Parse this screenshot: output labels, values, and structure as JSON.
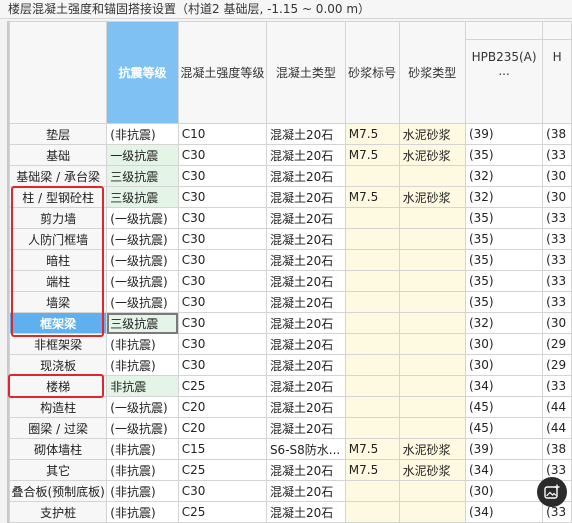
{
  "title": "楼层混凝土强度和锚固搭接设置（村道2  基础层, -1.15 ~ 0.00 m）",
  "headers": {
    "seismic": "抗震等级",
    "concrete_grade": "混凝土强度等级",
    "concrete_type": "混凝土类型",
    "mortar_grade": "砂浆标号",
    "mortar_type": "砂浆类型",
    "hpb235": "HPB235(A)",
    "hpb235_more": "...",
    "next_col": "H"
  },
  "rows": [
    {
      "name": "垫层",
      "seismic": "(非抗震)",
      "grade": "C10",
      "ctype": "混凝土20石",
      "mgrade": "M7.5",
      "mtype": "水泥砂浆",
      "hpb": "(39)",
      "next": "(38"
    },
    {
      "name": "基础",
      "seismic": "一级抗震",
      "grade": "C30",
      "ctype": "混凝土20石",
      "mgrade": "M7.5",
      "mtype": "水泥砂浆",
      "hpb": "(35)",
      "next": "(33"
    },
    {
      "name": "基础梁 / 承台梁",
      "seismic": "三级抗震",
      "grade": "C30",
      "ctype": "混凝土20石",
      "mgrade": "",
      "mtype": "",
      "hpb": "(32)",
      "next": "(30"
    },
    {
      "name": "柱 / 型钢砼柱",
      "seismic": "三级抗震",
      "grade": "C30",
      "ctype": "混凝土20石",
      "mgrade": "M7.5",
      "mtype": "水泥砂浆",
      "hpb": "(32)",
      "next": "(30"
    },
    {
      "name": "剪力墙",
      "seismic": "(一级抗震)",
      "grade": "C30",
      "ctype": "混凝土20石",
      "mgrade": "",
      "mtype": "",
      "hpb": "(35)",
      "next": "(33"
    },
    {
      "name": "人防门框墙",
      "seismic": "(一级抗震)",
      "grade": "C30",
      "ctype": "混凝土20石",
      "mgrade": "",
      "mtype": "",
      "hpb": "(35)",
      "next": "(33"
    },
    {
      "name": "暗柱",
      "seismic": "(一级抗震)",
      "grade": "C30",
      "ctype": "混凝土20石",
      "mgrade": "",
      "mtype": "",
      "hpb": "(35)",
      "next": "(33"
    },
    {
      "name": "端柱",
      "seismic": "(一级抗震)",
      "grade": "C30",
      "ctype": "混凝土20石",
      "mgrade": "",
      "mtype": "",
      "hpb": "(35)",
      "next": "(33"
    },
    {
      "name": "墙梁",
      "seismic": "(一级抗震)",
      "grade": "C30",
      "ctype": "混凝土20石",
      "mgrade": "",
      "mtype": "",
      "hpb": "(35)",
      "next": "(33"
    },
    {
      "name": "框架梁",
      "seismic": "三级抗震",
      "grade": "C30",
      "ctype": "混凝土20石",
      "mgrade": "",
      "mtype": "",
      "hpb": "(32)",
      "next": "(30"
    },
    {
      "name": "非框架梁",
      "seismic": "(非抗震)",
      "grade": "C30",
      "ctype": "混凝土20石",
      "mgrade": "",
      "mtype": "",
      "hpb": "(30)",
      "next": "(29"
    },
    {
      "name": "现浇板",
      "seismic": "(非抗震)",
      "grade": "C30",
      "ctype": "混凝土20石",
      "mgrade": "",
      "mtype": "",
      "hpb": "(30)",
      "next": "(29"
    },
    {
      "name": "楼梯",
      "seismic": "非抗震",
      "grade": "C25",
      "ctype": "混凝土20石",
      "mgrade": "",
      "mtype": "",
      "hpb": "(34)",
      "next": "(33"
    },
    {
      "name": "构造柱",
      "seismic": "(一级抗震)",
      "grade": "C20",
      "ctype": "混凝土20石",
      "mgrade": "",
      "mtype": "",
      "hpb": "(45)",
      "next": "(44"
    },
    {
      "name": "圈梁 / 过梁",
      "seismic": "(一级抗震)",
      "grade": "C20",
      "ctype": "混凝土20石",
      "mgrade": "",
      "mtype": "",
      "hpb": "(45)",
      "next": "(44"
    },
    {
      "name": "砌体墙柱",
      "seismic": "(非抗震)",
      "grade": "C15",
      "ctype": "S6-S8防水...",
      "mgrade": "M7.5",
      "mtype": "水泥砂浆",
      "hpb": "(39)",
      "next": "(38"
    },
    {
      "name": "其它",
      "seismic": "(非抗震)",
      "grade": "C25",
      "ctype": "混凝土20石",
      "mgrade": "M7.5",
      "mtype": "水泥砂浆",
      "hpb": "(34)",
      "next": "(33"
    },
    {
      "name": "叠合板(预制底板)",
      "seismic": "(非抗震)",
      "grade": "C30",
      "ctype": "混凝土20石",
      "mgrade": "",
      "mtype": "",
      "hpb": "(30)",
      "next": "(29"
    },
    {
      "name": "支护桩",
      "seismic": "(非抗震)",
      "grade": "C25",
      "ctype": "混凝土20石",
      "mgrade": "",
      "mtype": "",
      "hpb": "(34)",
      "next": "(33"
    }
  ],
  "colors": {
    "header_highlight": "#7fc1f2",
    "selected_row_header": "#5fb0ee",
    "seismic_editable": "#e4f5e8",
    "mortar_editable": "#fefae2",
    "annotation_red": "#e2252b"
  },
  "icons": {
    "floating_button": "image-add-icon"
  }
}
